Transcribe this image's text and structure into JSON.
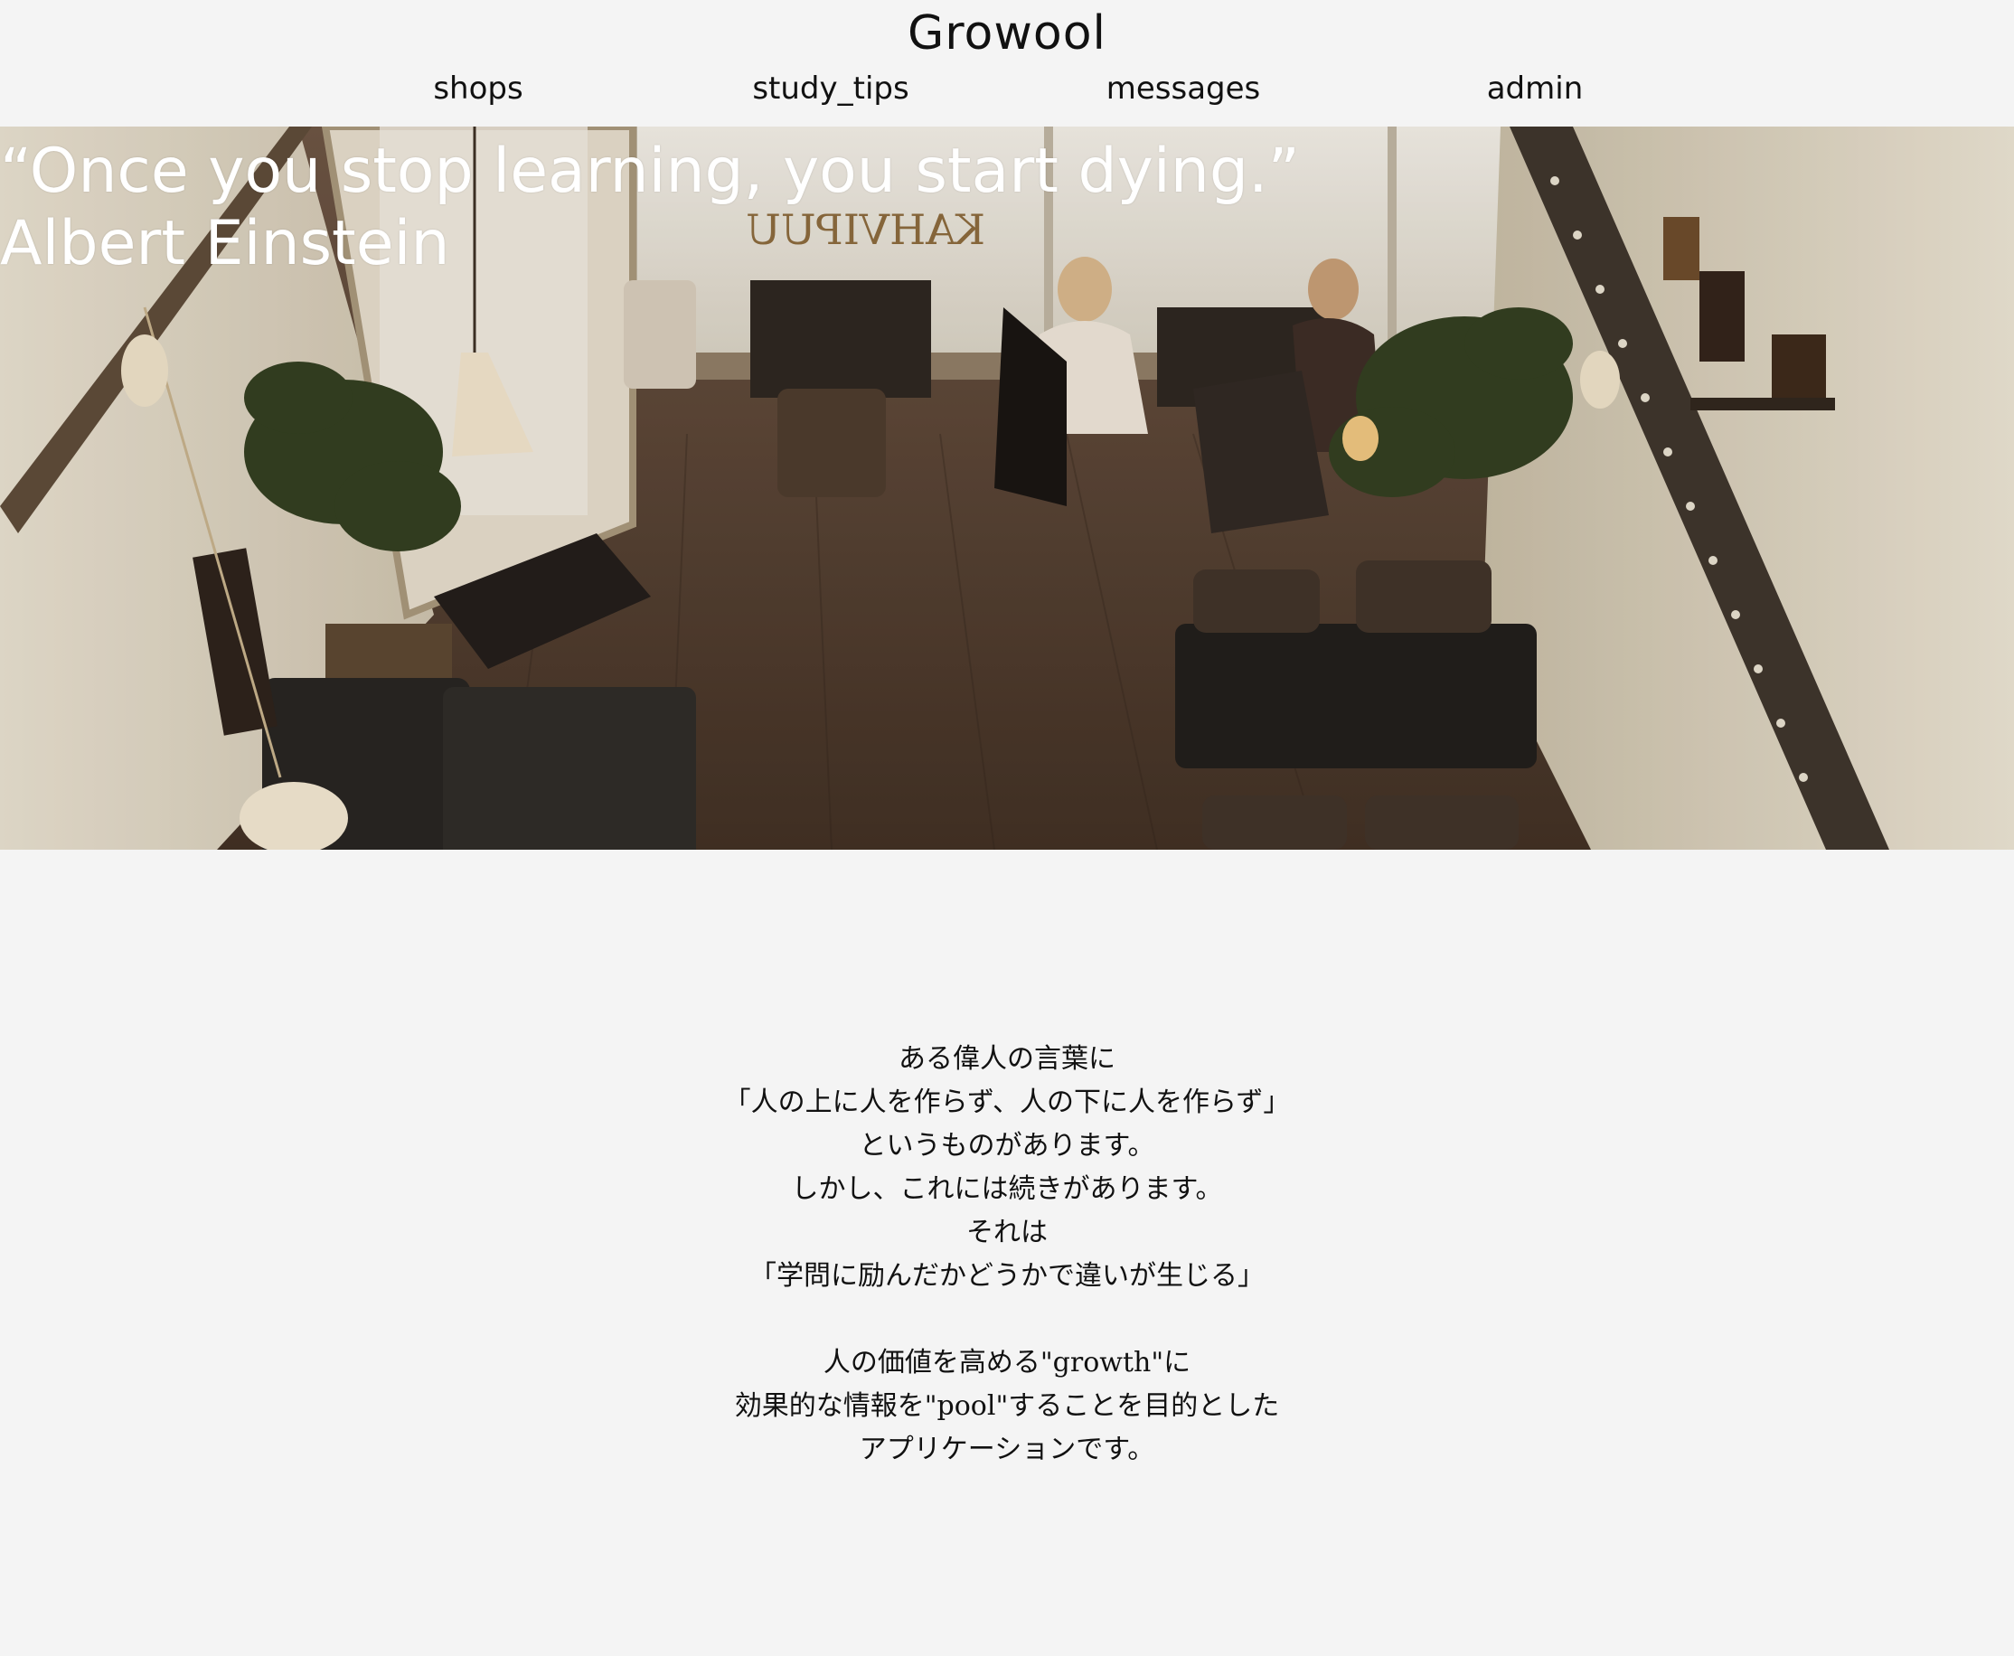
{
  "header": {
    "title": "Growool",
    "nav": [
      {
        "label": "shops"
      },
      {
        "label": "study_tips"
      },
      {
        "label": "messages"
      },
      {
        "label": "admin"
      }
    ]
  },
  "hero": {
    "quote_line1": "“Once you stop learning, you start dying.”",
    "quote_line2": "Albert Einstein",
    "image_subject": "overhead view of a cafe interior with two women talking at a window table",
    "window_sign": "KAHVIPUU"
  },
  "intro": {
    "paragraph1": [
      "ある偉人の言葉に",
      "「人の上に人を作らず、人の下に人を作らず」",
      "というものがあります。",
      "しかし、これには続きがあります。",
      "それは",
      "「学問に励んだかどうかで違いが生じる」"
    ],
    "paragraph2": [
      "人の価値を高める\"growth\"に",
      "効果的な情報を\"pool\"することを目的とした",
      "アプリケーションです。"
    ]
  },
  "colors": {
    "background": "#f4f4f4",
    "text": "#111111",
    "hero_text": "#ffffff"
  }
}
